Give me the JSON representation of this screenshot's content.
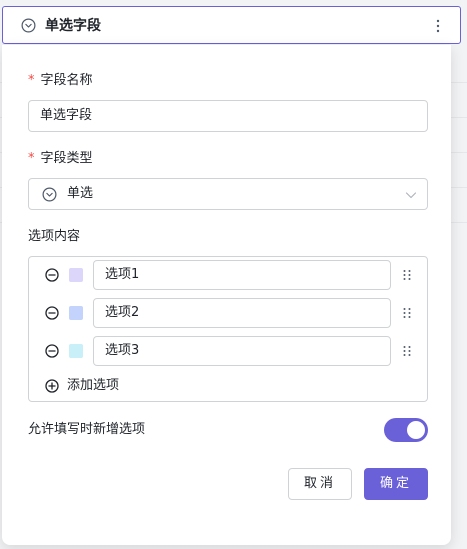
{
  "header": {
    "title": "单选字段",
    "icon": "circle-chevron-down-icon",
    "more_icon": "more-vertical-icon"
  },
  "form": {
    "field_name": {
      "required_mark": "*",
      "label": "字段名称",
      "value": "单选字段"
    },
    "field_type": {
      "required_mark": "*",
      "label": "字段类型",
      "value": "单选",
      "icon": "circle-chevron-down-icon"
    },
    "options": {
      "label": "选项内容",
      "items": [
        {
          "value": "选项1",
          "color": "#dcd6fb"
        },
        {
          "value": "选项2",
          "color": "#c4d3fb"
        },
        {
          "value": "选项3",
          "color": "#c9eff8"
        }
      ],
      "add_label": "添加选项"
    },
    "allow_add": {
      "label": "允许填写时新增选项",
      "enabled": true
    }
  },
  "buttons": {
    "cancel": "取消",
    "confirm": "确定"
  },
  "colors": {
    "accent": "#6a60d8",
    "required": "#f54a45",
    "border": "#d0d3d6"
  }
}
